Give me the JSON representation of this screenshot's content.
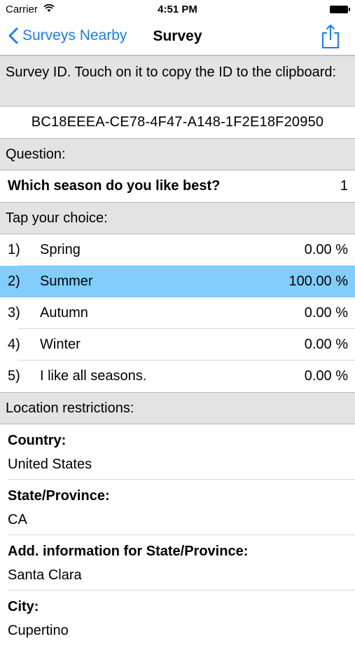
{
  "status": {
    "carrier": "Carrier",
    "time": "4:51 PM"
  },
  "nav": {
    "back_label": "Surveys Nearby",
    "title": "Survey"
  },
  "survey_header": "Survey ID. Touch on it to copy the ID to the clipboard:",
  "survey_id": "BC18EEEA-CE78-4F47-A148-1F2E18F20950",
  "question_header": "Question:",
  "question": {
    "text": "Which season do you like best?",
    "count": "1"
  },
  "choice_header": "Tap your choice:",
  "choices": [
    {
      "num": "1)",
      "label": "Spring",
      "pct": "0.00 %"
    },
    {
      "num": "2)",
      "label": "Summer",
      "pct": "100.00 %"
    },
    {
      "num": "3)",
      "label": "Autumn",
      "pct": "0.00 %"
    },
    {
      "num": "4)",
      "label": "Winter",
      "pct": "0.00 %"
    },
    {
      "num": "5)",
      "label": "I like all seasons.",
      "pct": "0.00 %"
    }
  ],
  "location_header": "Location restrictions:",
  "location": [
    {
      "key": "Country:",
      "value": "United States"
    },
    {
      "key": "State/Province:",
      "value": "CA"
    },
    {
      "key": "Add. information for State/Province:",
      "value": "Santa Clara"
    },
    {
      "key": "City:",
      "value": "Cupertino"
    }
  ],
  "colors": {
    "accent": "#1a7cf7",
    "selected": "#81cdfb",
    "header_bg": "#e3e3e3"
  }
}
